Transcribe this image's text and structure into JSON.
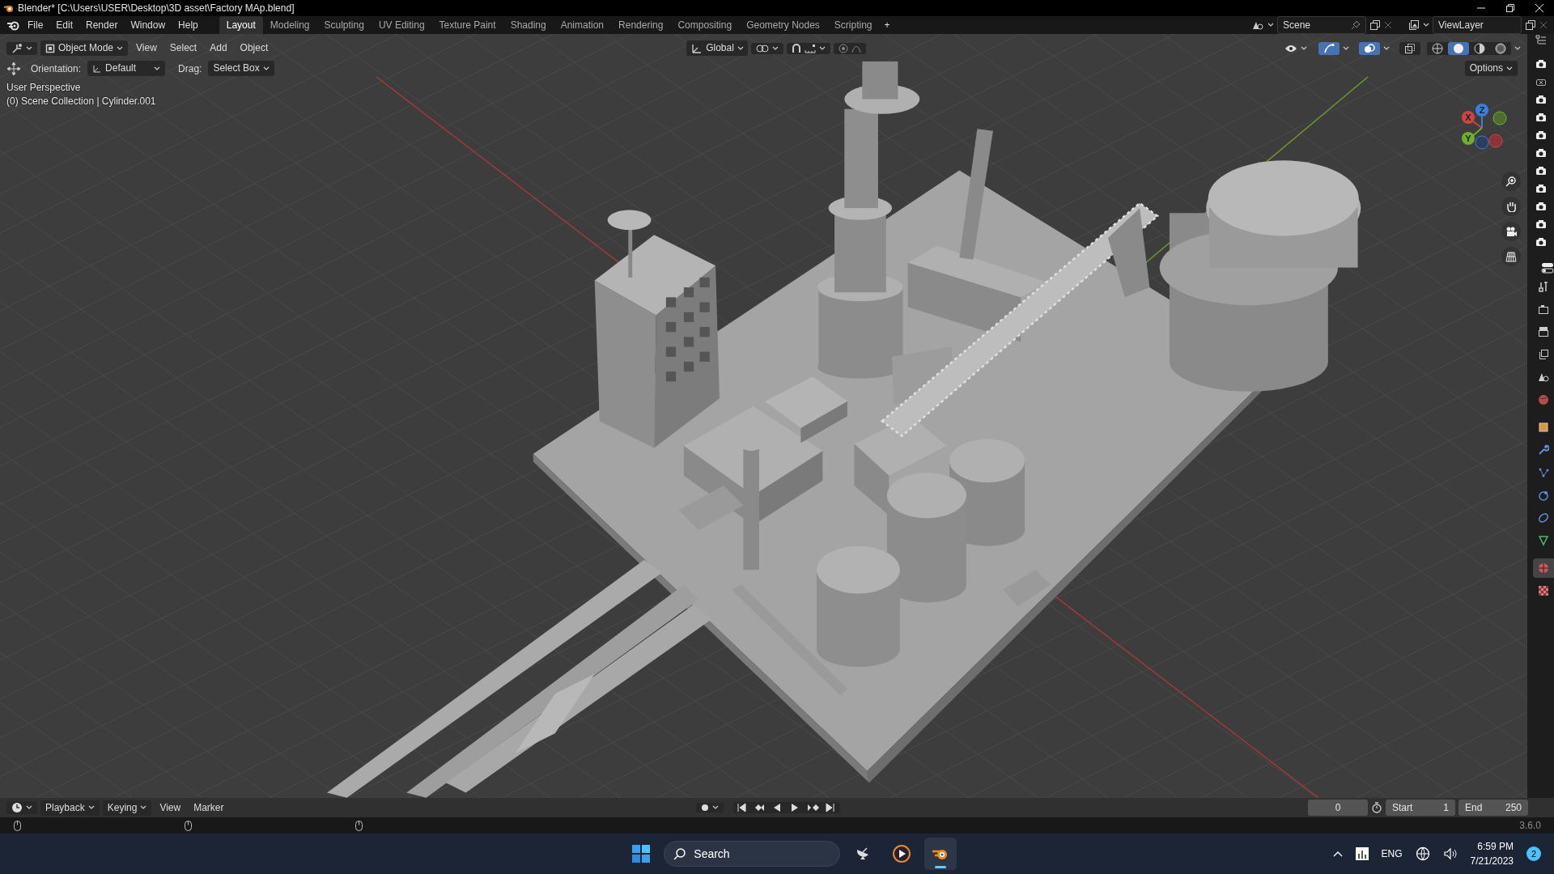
{
  "window": {
    "title": "Blender* [C:\\Users\\USER\\Desktop\\3D asset\\Factory MAp.blend]"
  },
  "menu": [
    "File",
    "Edit",
    "Render",
    "Window",
    "Help"
  ],
  "workspaces": [
    {
      "label": "Layout",
      "selected": true
    },
    {
      "label": "Modeling",
      "selected": false
    },
    {
      "label": "Sculpting",
      "selected": false
    },
    {
      "label": "UV Editing",
      "selected": false
    },
    {
      "label": "Texture Paint",
      "selected": false
    },
    {
      "label": "Shading",
      "selected": false
    },
    {
      "label": "Animation",
      "selected": false
    },
    {
      "label": "Rendering",
      "selected": false
    },
    {
      "label": "Compositing",
      "selected": false
    },
    {
      "label": "Geometry Nodes",
      "selected": false
    },
    {
      "label": "Scripting",
      "selected": false
    }
  ],
  "add_workspace": "+",
  "scene": "Scene",
  "view_layer": "ViewLayer",
  "viewport_header": {
    "mode": "Object Mode",
    "menus": [
      "View",
      "Select",
      "Add",
      "Object"
    ],
    "orientation": "Global",
    "gizmos_on": true,
    "overlays_on": true,
    "xray_on": false,
    "shading": [
      {
        "kind": "wireframe",
        "selected": false
      },
      {
        "kind": "solid",
        "selected": true
      },
      {
        "kind": "material",
        "selected": false
      },
      {
        "kind": "rendered",
        "selected": false
      }
    ]
  },
  "tool_settings": {
    "orientation_label": "Orientation:",
    "orientation": "Default",
    "drag_label": "Drag:",
    "drag": "Select Box",
    "options": "Options"
  },
  "viewport": {
    "perspective": "User Perspective",
    "collection": "(0) Scene Collection | Cylinder.001",
    "axes": [
      "X",
      "Y",
      "Z"
    ]
  },
  "outliner_render": [
    {
      "on": true
    },
    {
      "on": false
    },
    {
      "on": true
    },
    {
      "on": true
    },
    {
      "on": true
    },
    {
      "on": true
    },
    {
      "on": true
    },
    {
      "on": true
    },
    {
      "on": true
    },
    {
      "on": true
    },
    {
      "on": true
    }
  ],
  "properties_tabs": [
    {
      "kind": "tool",
      "selected": false
    },
    {
      "kind": "render",
      "selected": false
    },
    {
      "kind": "output",
      "selected": false
    },
    {
      "kind": "view_layer",
      "selected": false
    },
    {
      "kind": "scene",
      "selected": false
    },
    {
      "kind": "world",
      "selected": false
    },
    {
      "kind": "object",
      "selected": false
    },
    {
      "kind": "modifiers",
      "selected": false
    },
    {
      "kind": "particles",
      "selected": false
    },
    {
      "kind": "physics",
      "selected": false
    },
    {
      "kind": "constraints",
      "selected": false
    },
    {
      "kind": "data",
      "selected": false
    },
    {
      "kind": "material",
      "selected": true
    },
    {
      "kind": "texture",
      "selected": false
    }
  ],
  "timeline": {
    "menus": [
      "Playback",
      "Keying",
      "View",
      "Marker"
    ],
    "current_frame": "0",
    "start_label": "Start",
    "start": "1",
    "end_label": "End",
    "end": "250"
  },
  "status_bar": {
    "version": "3.6.0"
  },
  "taskbar": {
    "search": {
      "placeholder": "Search"
    },
    "apps": [
      {
        "kind": "satellite",
        "selected": false
      },
      {
        "kind": "player",
        "selected": false
      },
      {
        "kind": "blender",
        "selected": true
      }
    ],
    "language": "ENG",
    "time": "6:59 PM",
    "date": "7/21/2023",
    "notifications": "2"
  }
}
